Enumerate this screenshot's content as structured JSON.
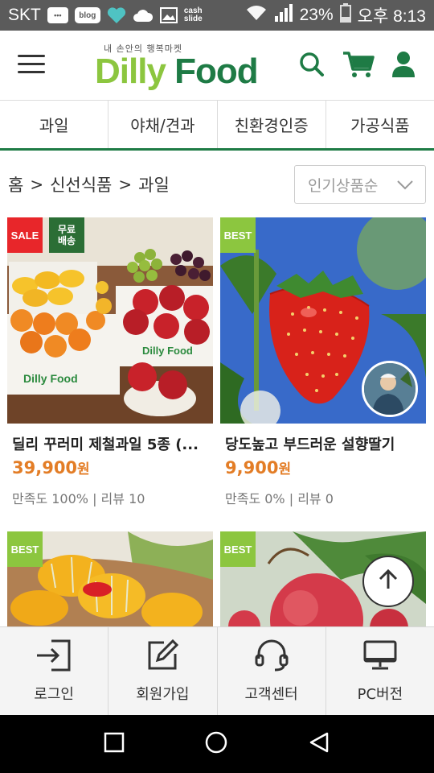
{
  "status_bar": {
    "carrier": "SKT",
    "blog_label": "blog",
    "cash_label_1": "cash",
    "cash_label_2": "slide",
    "battery": "23%",
    "time": "오후 8:13"
  },
  "header": {
    "logo_tagline": "내 손안의 행복마켓",
    "logo_word_1": "Dilly",
    "logo_word_2": "Food",
    "icons": [
      "menu-icon",
      "search-icon",
      "cart-icon",
      "user-icon"
    ],
    "brand_color": "#1e7b45",
    "accent_color": "#8cc63f"
  },
  "tabs": [
    {
      "label": "과일"
    },
    {
      "label": "야채/견과"
    },
    {
      "label": "친환경인증"
    },
    {
      "label": "가공식품"
    }
  ],
  "breadcrumb": {
    "items": [
      "홈",
      "신선식품",
      "과일"
    ],
    "separator": ">"
  },
  "sort": {
    "selected": "인기상품순"
  },
  "products": [
    {
      "badges": [
        "SALE",
        "무료\n배송"
      ],
      "name": "딜리 꾸러미 제철과일 5종 (...",
      "price": "39,900",
      "currency": "원",
      "rating": "만족도 100% | 리뷰 10"
    },
    {
      "badges": [
        "BEST"
      ],
      "name": "당도높고 부드러운 설향딸기",
      "price": "9,900",
      "currency": "원",
      "rating": "만족도 0% | 리뷰 0"
    },
    {
      "badges": [
        "BEST"
      ]
    },
    {
      "badges": [
        "BEST"
      ]
    }
  ],
  "bottom_menu": [
    {
      "label": "로그인",
      "icon": "login-icon"
    },
    {
      "label": "회원가입",
      "icon": "edit-icon"
    },
    {
      "label": "고객센터",
      "icon": "headset-icon"
    },
    {
      "label": "PC버전",
      "icon": "monitor-icon"
    }
  ],
  "price_color": "#e37d26",
  "sale_color": "#e8262a"
}
